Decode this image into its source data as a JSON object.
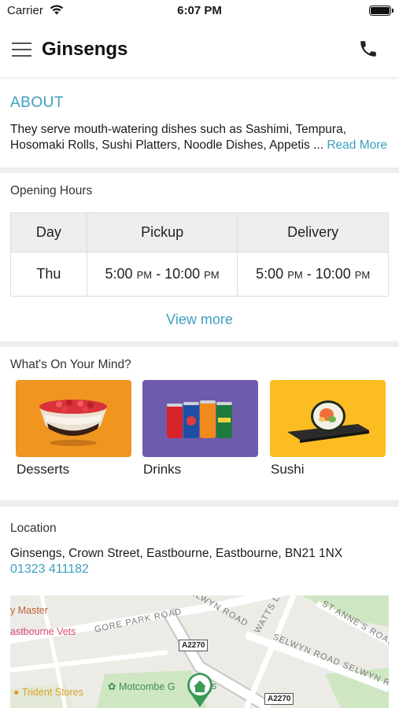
{
  "status_bar": {
    "carrier": "Carrier",
    "time": "6:07 PM"
  },
  "header": {
    "title": "Ginsengs",
    "menu_icon": "hamburger-menu-icon",
    "call_icon": "phone-icon"
  },
  "about": {
    "title": "ABOUT",
    "line1": "They serve mouth-watering dishes such as Sashimi, Tempura,",
    "line2": "Hosomaki Rolls, Sushi Platters, Noodle Dishes, Appetis ...",
    "read_more": "Read More"
  },
  "opening_hours": {
    "label": "Opening Hours",
    "columns": [
      "Day",
      "Pickup",
      "Delivery"
    ],
    "rows": [
      {
        "day": "Thu",
        "pickup": {
          "start": "5:00",
          "start_ampm": "PM",
          "sep": " - ",
          "end": "10:00",
          "end_ampm": "PM"
        },
        "delivery": {
          "start": "5:00",
          "start_ampm": "PM",
          "sep": " - ",
          "end": "10:00",
          "end_ampm": "PM"
        }
      }
    ],
    "view_more": "View more"
  },
  "categories": {
    "label": "What's On Your Mind?",
    "items": [
      {
        "label": "Desserts",
        "color": "#f0951f"
      },
      {
        "label": "Drinks",
        "color": "#6f5bab"
      },
      {
        "label": "Sushi",
        "color": "#fbbd22"
      }
    ]
  },
  "location": {
    "label": "Location",
    "address": "Ginsengs, Crown Street, Eastbourne, Eastbourne, BN21 1NX",
    "phone": "01323 411182",
    "map": {
      "labels": {
        "poi_master": "y Master",
        "poi_vets": "astbourne Vets",
        "road_gore_park": "GORE PARK ROAD",
        "road_selwyn_top": "SELWYN ROAD",
        "road_watts": "WATTS L",
        "road_st_annes": "ST ANNE'S ROAD",
        "road_selwyn_lower": "SELWYN ROAD  SELWYN RD",
        "shield_a2270_1": "A2270",
        "shield_a2270_2": "A2270",
        "poi_trident": "Trident Stores",
        "poi_motcombe": "Motcombe G",
        "poi_motcombe_tail": "s"
      }
    }
  },
  "colors": {
    "accent": "#3e9fc0",
    "divider": "#eeeeee"
  }
}
